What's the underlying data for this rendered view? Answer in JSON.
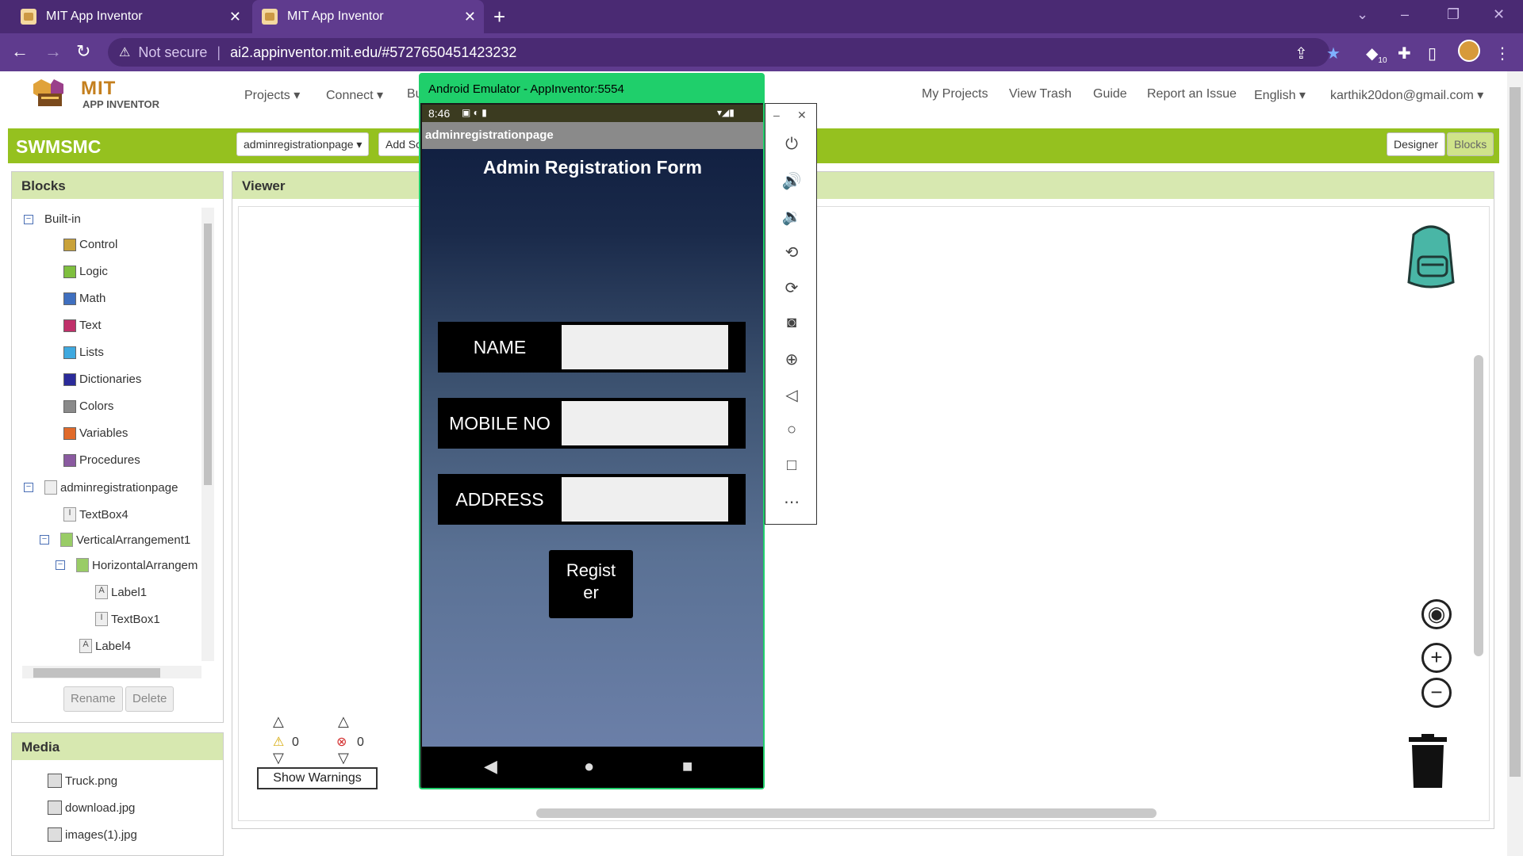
{
  "browser": {
    "tabs": [
      {
        "title": "MIT App Inventor",
        "active": false
      },
      {
        "title": "MIT App Inventor",
        "active": true
      }
    ],
    "security_label": "Not secure",
    "url": "ai2.appinventor.mit.edu/#5727650451423232",
    "extension_badge": "10"
  },
  "header": {
    "logo_mit": "MIT",
    "logo_sub": "APP INVENTOR",
    "menu": {
      "projects": "Projects ▾",
      "connect": "Connect ▾",
      "build": "Bu"
    },
    "right_menu": {
      "my_projects": "My Projects",
      "view_trash": "View Trash",
      "guide": "Guide",
      "report": "Report an Issue",
      "language": "English ▾",
      "account": "karthik20don@gmail.com ▾"
    }
  },
  "project": {
    "name": "SWMSMC",
    "screen_select": "adminregistrationpage ▾",
    "add_screen": "Add Sc",
    "designer": "Designer",
    "blocks": "Blocks"
  },
  "blocks_panel": {
    "title": "Blocks",
    "builtin": "Built-in",
    "builtin_items": [
      {
        "label": "Control",
        "color": "#c9a23a"
      },
      {
        "label": "Logic",
        "color": "#7fbf3f"
      },
      {
        "label": "Math",
        "color": "#3f6fbf"
      },
      {
        "label": "Text",
        "color": "#c0306a"
      },
      {
        "label": "Lists",
        "color": "#3fa9df"
      },
      {
        "label": "Dictionaries",
        "color": "#2b2b9a"
      },
      {
        "label": "Colors",
        "color": "#8a8a8a"
      },
      {
        "label": "Variables",
        "color": "#e06a2a"
      },
      {
        "label": "Procedures",
        "color": "#8a5aa0"
      }
    ],
    "screen": "adminregistrationpage",
    "components": {
      "textbox4": "TextBox4",
      "vertical1": "VerticalArrangement1",
      "horizontal": "HorizontalArrangem",
      "label1": "Label1",
      "textbox1": "TextBox1",
      "label4": "Label4"
    },
    "rename": "Rename",
    "delete": "Delete"
  },
  "media_panel": {
    "title": "Media",
    "files": [
      "Truck.png",
      "download.jpg",
      "images(1).jpg"
    ]
  },
  "viewer": {
    "title": "Viewer",
    "warning_count": "0",
    "error_count": "0",
    "show_warnings": "Show Warnings"
  },
  "emulator": {
    "title": "Android Emulator - AppInventor:5554",
    "time": "8:46",
    "screen_title": "adminregistrationpage",
    "form_title": "Admin Registration Form",
    "fields": {
      "name": "NAME",
      "mobile": "MOBILE NO",
      "address": "ADDRESS"
    },
    "register_line1": "Regist",
    "register_line2": "er"
  }
}
